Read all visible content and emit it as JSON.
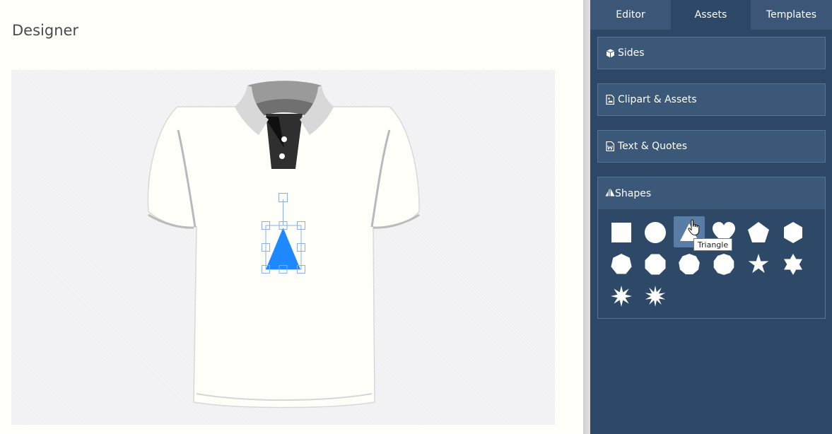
{
  "page": {
    "title": "Designer"
  },
  "tabs": [
    {
      "label": "Editor",
      "active": false
    },
    {
      "label": "Assets",
      "active": true
    },
    {
      "label": "Templates",
      "active": false
    }
  ],
  "panels": {
    "sides": {
      "label": "Sides",
      "icon": "cube-icon"
    },
    "clipart": {
      "label": "Clipart & Assets",
      "icon": "image-file-icon"
    },
    "text": {
      "label": "Text & Quotes",
      "icon": "word-file-icon"
    },
    "shapes": {
      "label": "Shapes",
      "icon": "shapes-icon"
    }
  },
  "shapes": [
    "square",
    "circle",
    "triangle",
    "heart",
    "pentagon",
    "hexagon",
    "heptagon",
    "octagon",
    "nonagon",
    "decagon",
    "star-5",
    "star-6",
    "star-8",
    "star-10"
  ],
  "hovered_shape": "triangle",
  "tooltip": {
    "text": "Triangle"
  },
  "colors": {
    "sidebar_bg": "#2d4766",
    "panel_bg": "#3c5878",
    "selected_shape_fill": "#1e88ff",
    "selection_handle": "#8aaee6"
  }
}
